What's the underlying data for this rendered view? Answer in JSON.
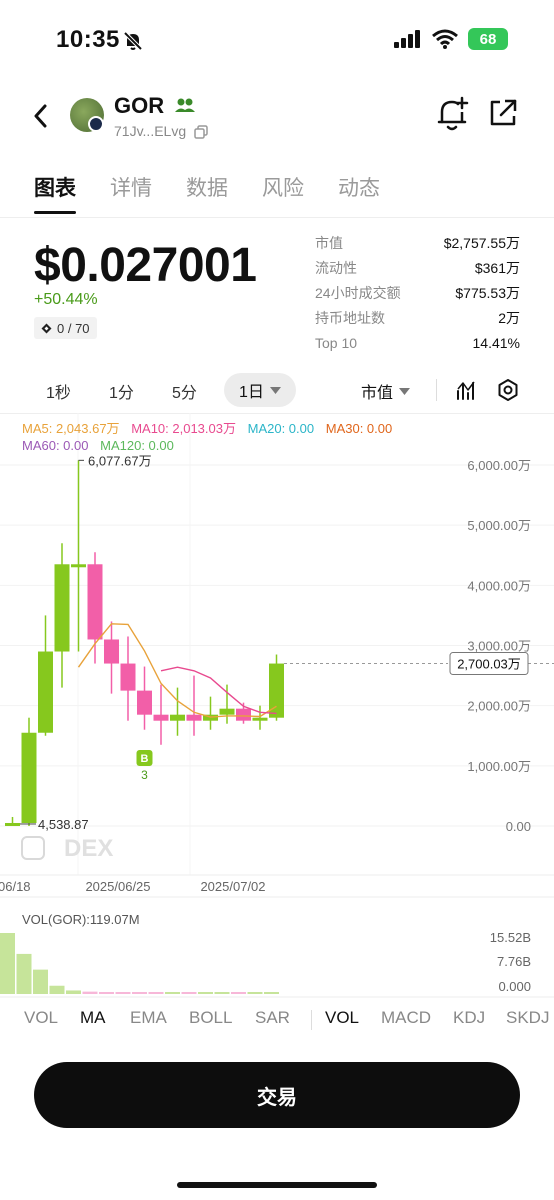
{
  "status_bar": {
    "time": "10:35",
    "battery": "68"
  },
  "header": {
    "name": "GOR",
    "address": "71Jv...ELvg"
  },
  "tabs": [
    {
      "label": "图表",
      "active": true
    },
    {
      "label": "详情",
      "active": false
    },
    {
      "label": "数据",
      "active": false
    },
    {
      "label": "风险",
      "active": false
    },
    {
      "label": "动态",
      "active": false
    }
  ],
  "price": {
    "value": "$0.027001",
    "change": "+50.44%",
    "rank": "0 / 70"
  },
  "stats": [
    {
      "label": "市值",
      "value": "$2,757.55万"
    },
    {
      "label": "流动性",
      "value": "$361万"
    },
    {
      "label": "24小时成交额",
      "value": "$775.53万"
    },
    {
      "label": "持币地址数",
      "value": "2万"
    },
    {
      "label": "Top 10",
      "value": "14.41%"
    }
  ],
  "intervals": {
    "items": [
      "1秒",
      "1分",
      "5分"
    ],
    "active": "1日",
    "metric": "市值"
  },
  "ma_legend": {
    "ma5": "MA5: 2,043.67万",
    "ma10": "MA10: 2,013.03万",
    "ma20": "MA20: 0.00",
    "ma30": "MA30: 0.00",
    "ma60": "MA60: 0.00",
    "ma120": "MA120: 0.00"
  },
  "colors": {
    "up": "#86c81e",
    "down": "#f25fa8",
    "ma5": "#e8a23a",
    "ma10": "#e84a8f",
    "ma20": "#2bb5c8",
    "ma30": "#e0661c",
    "ma60": "#9b59b6",
    "ma120": "#5cb85c"
  },
  "chart_data": {
    "type": "candlestick",
    "unit": "万",
    "y_ticks": [
      "6,000.00万",
      "5,000.00万",
      "4,000.00万",
      "3,000.00万",
      "2,000.00万",
      "1,000.00万",
      "0.00"
    ],
    "y_tick_values": [
      6000,
      5000,
      4000,
      3000,
      2000,
      1000,
      0
    ],
    "x_labels": [
      "06/18",
      "2025/06/25",
      "2025/07/02"
    ],
    "current_value_label": "2,700.03万",
    "current_value": 2700.03,
    "high_label": "6,077.67万",
    "high_value": 6077.67,
    "low_label": "4,538.87",
    "low_value": 0.45,
    "candles": [
      {
        "o": 0.45,
        "h": 150,
        "l": 0.45,
        "c": 50
      },
      {
        "o": 50,
        "h": 1800,
        "l": 0,
        "c": 1550
      },
      {
        "o": 1550,
        "h": 3500,
        "l": 1500,
        "c": 2900
      },
      {
        "o": 2900,
        "h": 4700,
        "l": 2300,
        "c": 4350
      },
      {
        "o": 4350,
        "h": 6077.67,
        "l": 2900,
        "c": 4350
      },
      {
        "o": 4350,
        "h": 4550,
        "l": 2700,
        "c": 3100
      },
      {
        "o": 3100,
        "h": 3400,
        "l": 2200,
        "c": 2700
      },
      {
        "o": 2700,
        "h": 3150,
        "l": 1750,
        "c": 2250
      },
      {
        "o": 2250,
        "h": 2650,
        "l": 1600,
        "c": 1850
      },
      {
        "o": 1850,
        "h": 2350,
        "l": 1350,
        "c": 1750
      },
      {
        "o": 1750,
        "h": 2300,
        "l": 1500,
        "c": 1850
      },
      {
        "o": 1850,
        "h": 2500,
        "l": 1500,
        "c": 1750
      },
      {
        "o": 1750,
        "h": 2150,
        "l": 1600,
        "c": 1850
      },
      {
        "o": 1850,
        "h": 2350,
        "l": 1700,
        "c": 1950
      },
      {
        "o": 1950,
        "h": 2050,
        "l": 1700,
        "c": 1750
      },
      {
        "o": 1750,
        "h": 2000,
        "l": 1600,
        "c": 1800
      },
      {
        "o": 1800,
        "h": 2850,
        "l": 1750,
        "c": 2700
      }
    ],
    "ma5": [
      null,
      null,
      null,
      null,
      2640,
      3030,
      3360,
      3350,
      2910,
      2370,
      2080,
      1890,
      1810,
      1830,
      1830,
      1820,
      1990
    ],
    "ma10": [
      null,
      null,
      null,
      null,
      null,
      null,
      null,
      null,
      null,
      2580,
      2640,
      2580,
      2460,
      2220,
      1990,
      1890,
      1870
    ],
    "buy_marker": {
      "label": "B",
      "count": "3"
    },
    "volume": {
      "label": "VOL(GOR):119.07M",
      "y_ticks": [
        "15.52B",
        "7.76B",
        "0.000"
      ],
      "values": [
        15.52,
        10.2,
        6.2,
        2.1,
        0.9,
        0.6,
        0.5,
        0.4,
        0.35,
        0.3,
        0.25,
        0.2,
        0.15,
        0.12,
        0.1,
        0.08,
        0.07
      ]
    }
  },
  "watermark": "DEX",
  "indicators": {
    "main": [
      "VOL",
      "MA",
      "EMA",
      "BOLL",
      "SAR"
    ],
    "sub": [
      "VOL",
      "MACD",
      "KDJ",
      "SKDJ"
    ],
    "main_active": "MA",
    "sub_active": "VOL"
  },
  "trade_button": "交易"
}
